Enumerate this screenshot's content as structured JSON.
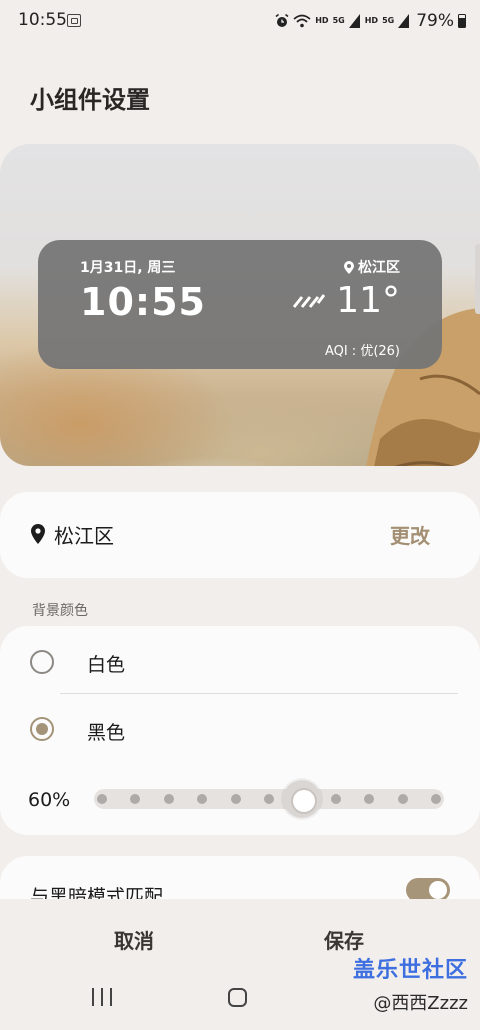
{
  "status_bar": {
    "time": "10:55",
    "net_hd1": "HD",
    "net_5g1": "5G",
    "net_hd2": "HD",
    "net_5g2": "5G",
    "battery": "79%"
  },
  "page": {
    "title": "小组件设置"
  },
  "widget": {
    "date": "1月31日, 周三",
    "time": "10:55",
    "location": "松江区",
    "temperature": "11°",
    "aqi": "AQI : 优(26)",
    "weather_icon": "rain-icon"
  },
  "location": {
    "name": "松江区",
    "change_label": "更改"
  },
  "background_color": {
    "section_label": "背景颜色",
    "options": [
      {
        "label": "白色",
        "selected": false
      },
      {
        "label": "黑色",
        "selected": true
      }
    ],
    "opacity_text": "60%",
    "opacity_value": 0.6,
    "slider_steps": 11
  },
  "dark_mode": {
    "label": "与黑暗模式匹配",
    "enabled": true
  },
  "actions": {
    "cancel": "取消",
    "save": "保存"
  },
  "overlay": {
    "community": "盖乐世社区",
    "watermark": "@西西Zzzz"
  },
  "colors": {
    "accent": "#a79579",
    "widget_bg": "#767676",
    "page_bg": "#f2eeec"
  }
}
